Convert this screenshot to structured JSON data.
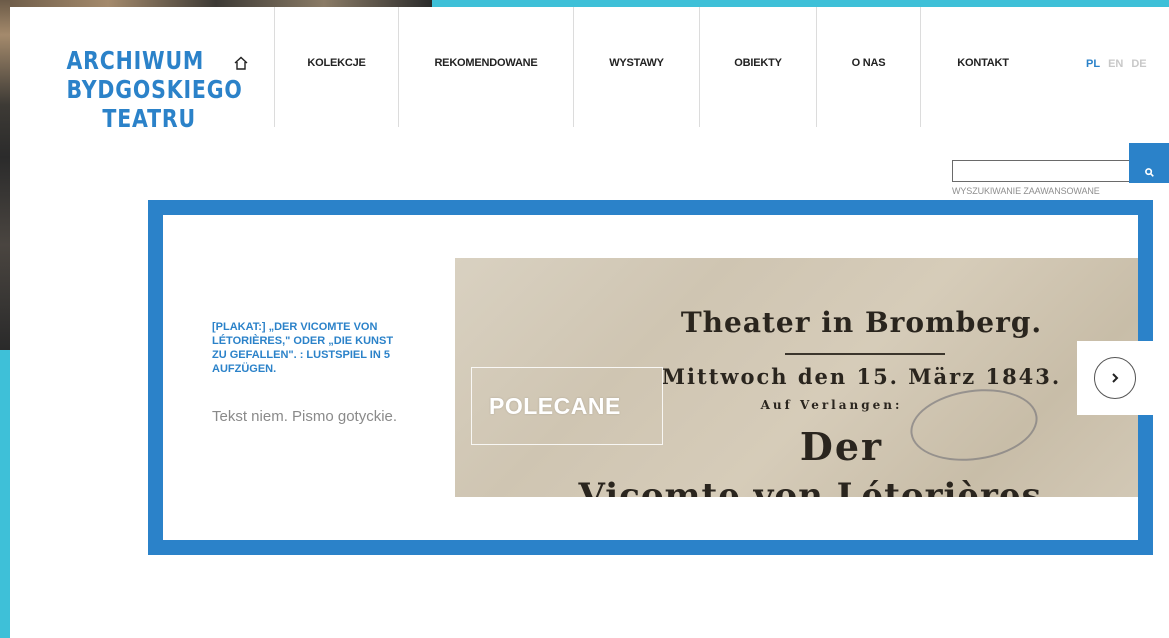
{
  "logo": {
    "lines": [
      "ARCHIWUM",
      "BYDGOSKIEGO",
      "TEATRU"
    ]
  },
  "nav": {
    "home_icon": "home-icon",
    "items": [
      {
        "label": "KOLEKCJE"
      },
      {
        "label": "REKOMENDOWANE"
      },
      {
        "label": "WYSTAWY"
      },
      {
        "label": "OBIEKTY"
      },
      {
        "label": "O NAS"
      },
      {
        "label": "KONTAKT"
      }
    ]
  },
  "languages": [
    {
      "code": "PL",
      "active": true
    },
    {
      "code": "EN",
      "active": false
    },
    {
      "code": "DE",
      "active": false
    }
  ],
  "search": {
    "value": "",
    "placeholder": "",
    "button_icon": "search-icon",
    "advanced_label": "WYSZUKIWANIE ZAAWANSOWANE"
  },
  "slide": {
    "title": "[PLAKAT:] „DER VICOMTE VON LÉTORIÈRES,\" ODER „DIE KUNST ZU GEFALLEN\". : LUSTSPIEL IN 5 AUFZÜGEN.",
    "description": "Tekst niem. Pismo gotyckie.",
    "badge": "POLECANE",
    "poster_lines": {
      "line1": "Theater in Bromberg.",
      "line2": "Mittwoch den 15. März 1843.",
      "line3": "Auf Verlangen:",
      "line4": "Der",
      "line5": "Vicomte von Létorières."
    },
    "next_icon": "chevron-right-icon"
  },
  "colors": {
    "accent": "#2b82c9",
    "cyan": "#3ec0d8",
    "text_dark": "#222222",
    "text_muted": "#8a8a8a"
  }
}
